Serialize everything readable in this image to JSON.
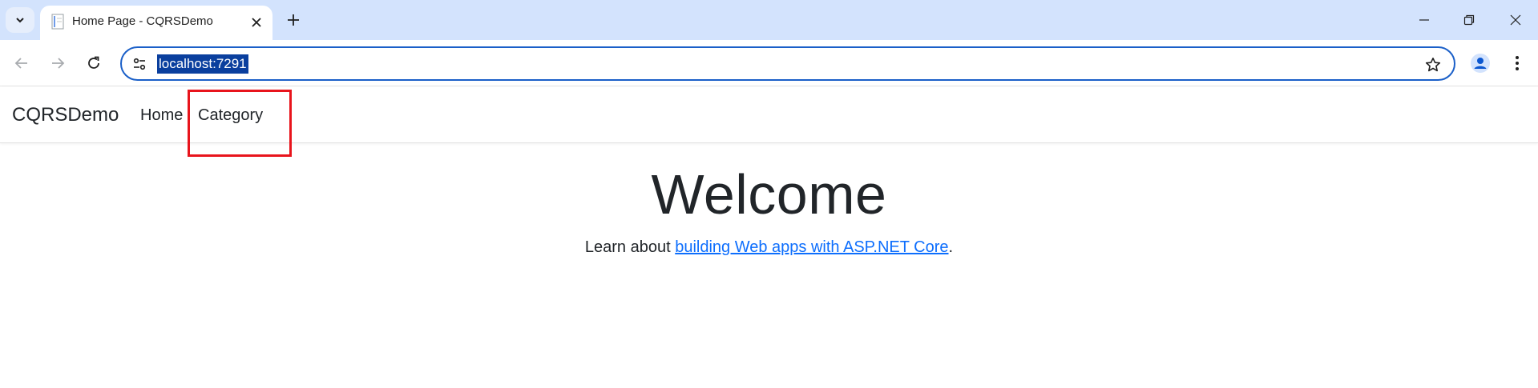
{
  "browser": {
    "tab": {
      "title": "Home Page - CQRSDemo"
    },
    "omnibox": {
      "url": "localhost:7291"
    }
  },
  "icons": {
    "tab_search": "chevron-down-icon",
    "favicon": "document-icon",
    "tab_close": "close-icon",
    "new_tab": "plus-icon",
    "minimize": "minimize-icon",
    "restore": "restore-icon",
    "close_window": "close-icon",
    "back": "arrow-left-icon",
    "forward": "arrow-right-icon",
    "reload": "reload-icon",
    "site_info": "tune-icon",
    "bookmark": "star-icon",
    "profile": "person-icon",
    "menu": "kebab-menu-icon"
  },
  "site": {
    "brand": "CQRSDemo",
    "nav": [
      {
        "label": "Home"
      },
      {
        "label": "Category"
      }
    ],
    "heading": "Welcome",
    "learn": {
      "prefix": "Learn about ",
      "link": "building Web apps with ASP.NET Core",
      "suffix": "."
    }
  },
  "colors": {
    "tabstrip": "#d3e3fd",
    "omnibox_border": "#1a5fc8",
    "url_selection": "#0a3f9e",
    "link": "#0d6efd",
    "annotation": "#e8141c"
  }
}
